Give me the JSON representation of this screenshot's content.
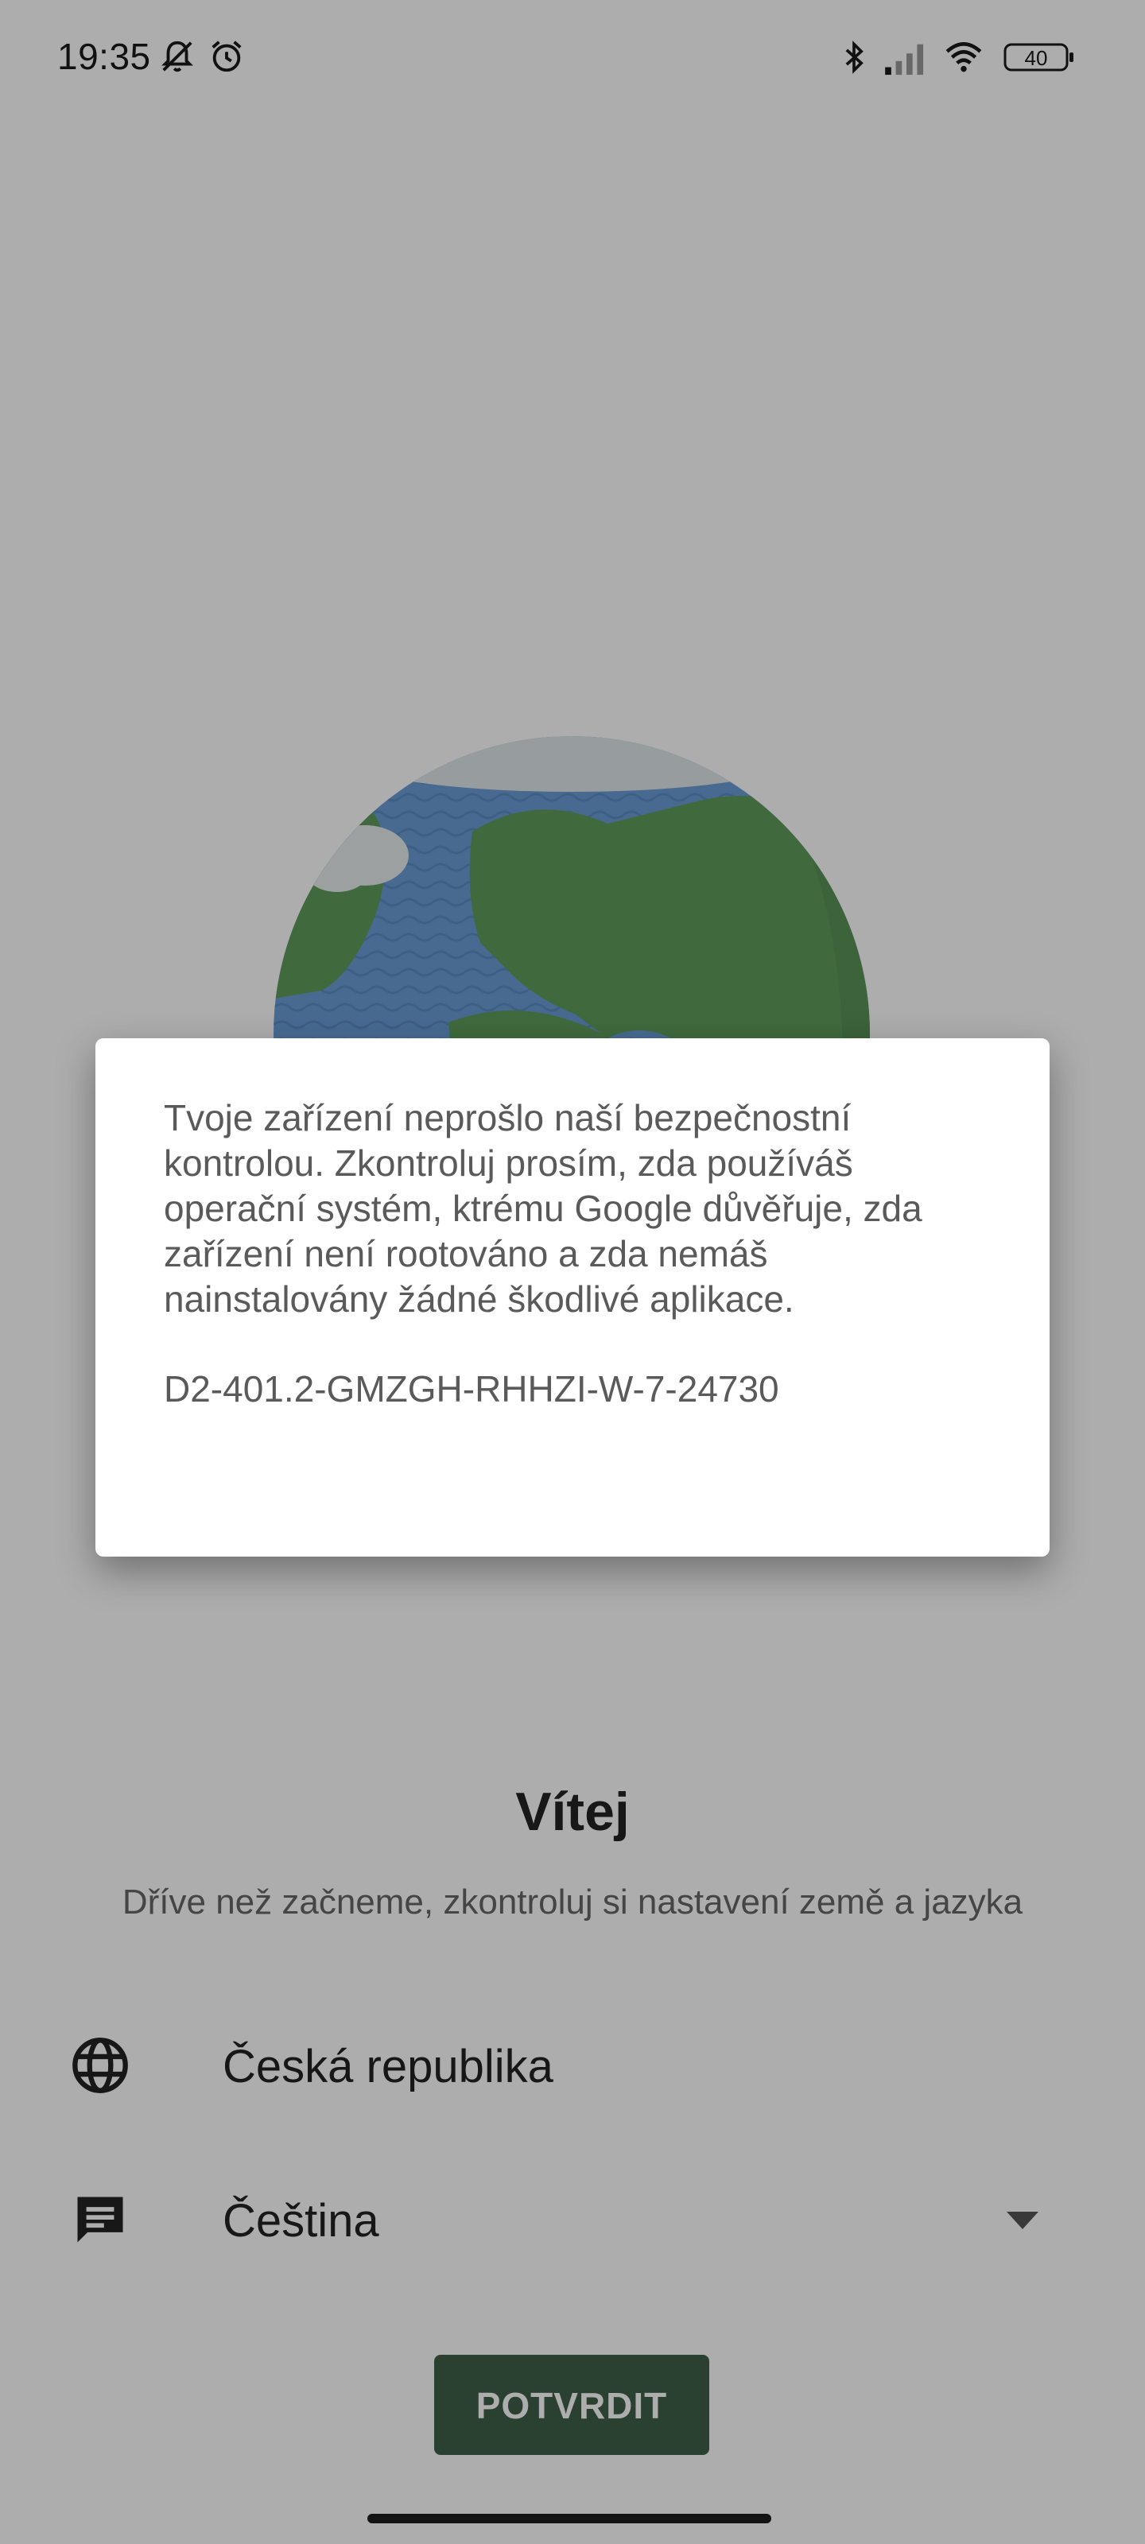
{
  "status_bar": {
    "time": "19:35",
    "battery_level": "40",
    "icons": [
      "bell-off-icon",
      "alarm-icon",
      "bluetooth-icon",
      "signal-icon",
      "wifi-icon",
      "battery-icon"
    ]
  },
  "welcome": {
    "title": "Vítej",
    "subtitle": "Dříve než začneme, zkontroluj si nastavení země a jazyka"
  },
  "settings": {
    "country": {
      "label": "Česká republika",
      "icon": "globe-icon"
    },
    "language": {
      "label": "Čeština",
      "icon": "chat-icon"
    }
  },
  "confirm_button": {
    "label": "POTVRDIT"
  },
  "dialog": {
    "message": "Tvoje zařízení neprošlo naší bezpečnostní kontrolou. Zkontroluj prosím, zda používáš operační systém, ktrému Google důvěřuje, zda zařízení není rootováno a zda nemáš nainstalovány žádné škodlivé aplikace.",
    "code": "D2-401.2-GMZGH-RHHZI-W-7-24730"
  },
  "colors": {
    "accent": "#3e5f48",
    "scrim": "#000000",
    "dialog_bg": "#ffffff"
  }
}
